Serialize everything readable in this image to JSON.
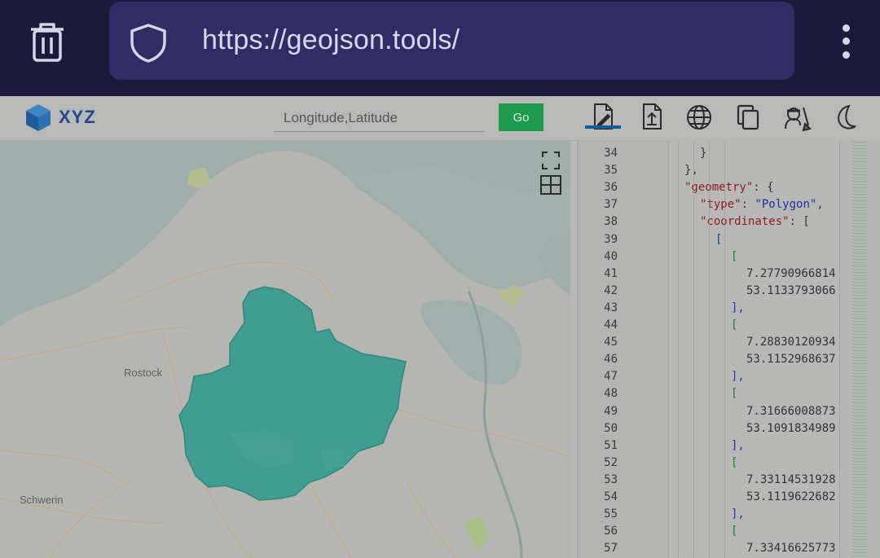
{
  "browser": {
    "url": "https://geojson.tools/",
    "icons": {
      "left": "trash-icon",
      "security": "shield-icon",
      "menu": "kebab-menu-icon"
    }
  },
  "toolbar": {
    "logo_text": "XYZ",
    "coord_placeholder": "Longitude,Latitude",
    "go_label": "Go",
    "tools": [
      "edit-icon",
      "upload-icon",
      "globe-icon",
      "copy-icon",
      "clean-icon",
      "dark-mode-icon"
    ]
  },
  "map": {
    "labels": {
      "rostock": "Rostock",
      "schwerin": "Schwerin"
    },
    "controls": [
      "fullscreen-icon",
      "grid-layers-icon"
    ],
    "colors": {
      "polygon": "#3f9d92",
      "water": "#a1aeac",
      "land": "#b5b6b1"
    }
  },
  "editor": {
    "lines": [
      {
        "n": "34",
        "text": "}"
      },
      {
        "n": "35",
        "text": "},"
      },
      {
        "n": "36",
        "key": "\"geometry\"",
        "rest": ": {"
      },
      {
        "n": "37",
        "key": "\"type\"",
        "mid": ": ",
        "val": "\"Polygon\"",
        "rest": ","
      },
      {
        "n": "38",
        "key": "\"coordinates\"",
        "rest": ": ["
      },
      {
        "n": "39",
        "text": "["
      },
      {
        "n": "40",
        "text": "["
      },
      {
        "n": "41",
        "text": "7.27790966814"
      },
      {
        "n": "42",
        "text": "53.1133793066"
      },
      {
        "n": "43",
        "text": "],"
      },
      {
        "n": "44",
        "text": "["
      },
      {
        "n": "45",
        "text": "7.28830120934"
      },
      {
        "n": "46",
        "text": "53.1152968637"
      },
      {
        "n": "47",
        "text": "],"
      },
      {
        "n": "48",
        "text": "["
      },
      {
        "n": "49",
        "text": "7.31666008873"
      },
      {
        "n": "50",
        "text": "53.1091834989"
      },
      {
        "n": "51",
        "text": "],"
      },
      {
        "n": "52",
        "text": "["
      },
      {
        "n": "53",
        "text": "7.33114531928"
      },
      {
        "n": "54",
        "text": "53.1119622682"
      },
      {
        "n": "55",
        "text": "],"
      },
      {
        "n": "56",
        "text": "["
      },
      {
        "n": "57",
        "text": "7.33416625773"
      }
    ]
  }
}
